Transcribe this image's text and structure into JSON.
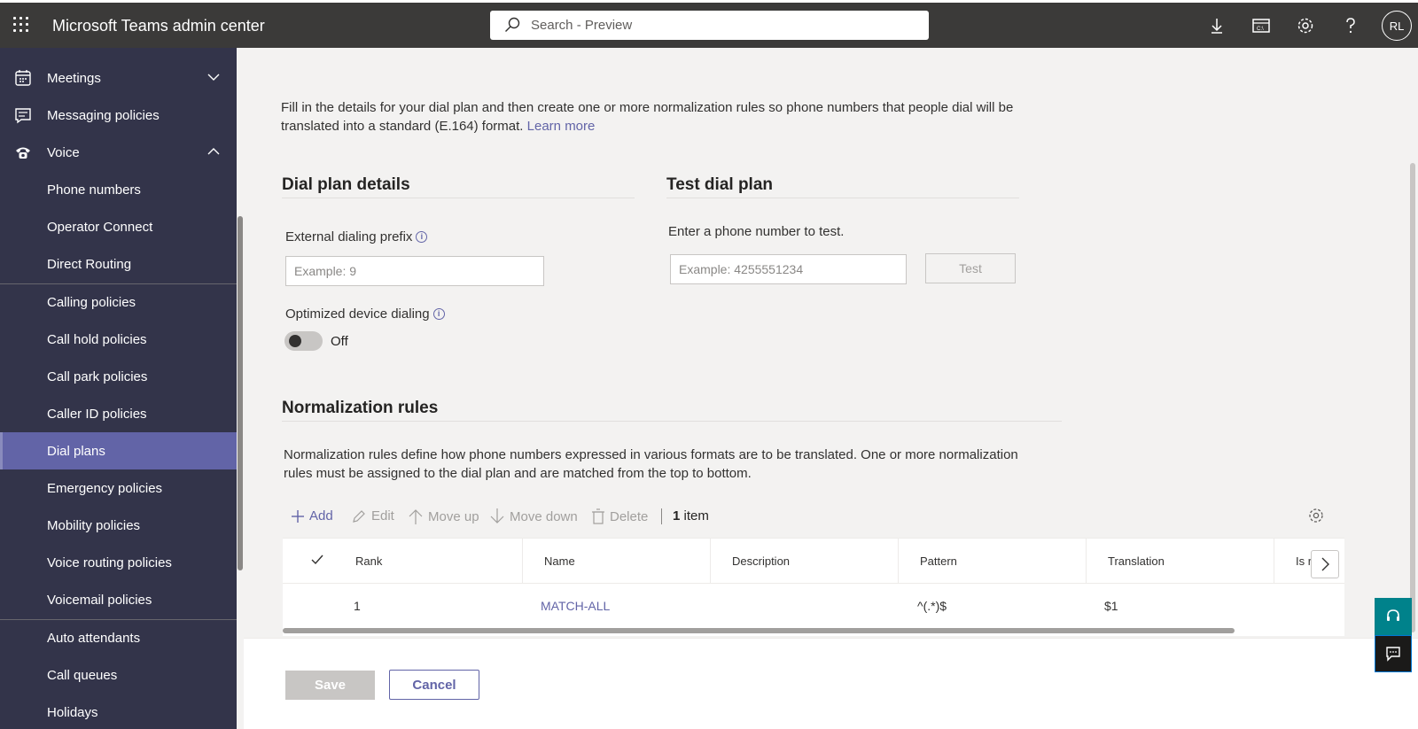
{
  "header": {
    "app_title": "Microsoft Teams admin center",
    "search_placeholder": "Search - Preview",
    "avatar_initials": "RL",
    "icons": [
      "waffle-icon",
      "search-icon",
      "download-icon",
      "shell-icon",
      "settings-icon",
      "help-icon"
    ]
  },
  "sidebar": {
    "items": [
      {
        "label": "Meetings",
        "icon": "calendar-icon",
        "expandable": true,
        "expanded": false
      },
      {
        "label": "Messaging policies",
        "icon": "chat-icon"
      },
      {
        "label": "Voice",
        "icon": "phone-icon",
        "expandable": true,
        "expanded": true
      },
      {
        "label": "Phone numbers"
      },
      {
        "label": "Operator Connect"
      },
      {
        "label": "Direct Routing"
      },
      {
        "label": "Calling policies"
      },
      {
        "label": "Call hold policies"
      },
      {
        "label": "Call park policies"
      },
      {
        "label": "Caller ID policies"
      },
      {
        "label": "Dial plans",
        "active": true
      },
      {
        "label": "Emergency policies"
      },
      {
        "label": "Mobility policies"
      },
      {
        "label": "Voice routing policies"
      },
      {
        "label": "Voicemail policies"
      },
      {
        "label": "Auto attendants"
      },
      {
        "label": "Call queues"
      },
      {
        "label": "Holidays"
      }
    ]
  },
  "intro": {
    "text": "Fill in the details for your dial plan and then create one or more normalization rules so phone numbers that people dial will be translated into a standard (E.164) format.",
    "link": "Learn more"
  },
  "dial_plan_details": {
    "title": "Dial plan details",
    "external_prefix_label": "External dialing prefix",
    "external_prefix_placeholder": "Example: 9",
    "optimized_label": "Optimized device dialing",
    "optimized_state": "Off"
  },
  "test_dial_plan": {
    "title": "Test dial plan",
    "prompt": "Enter a phone number to test.",
    "input_placeholder": "Example: 4255551234",
    "button": "Test"
  },
  "normalization": {
    "title": "Normalization rules",
    "description": "Normalization rules define how phone numbers expressed in various formats are to be translated. One or more normalization rules must be assigned to the dial plan and are matched from the top to bottom.",
    "commands": {
      "add": "Add",
      "edit": "Edit",
      "move_up": "Move up",
      "move_down": "Move down",
      "delete": "Delete",
      "count": "1",
      "count_label": "item"
    },
    "columns": [
      "Rank",
      "Name",
      "Description",
      "Pattern",
      "Translation",
      "Is r"
    ],
    "rows": [
      {
        "rank": "1",
        "name": "MATCH-ALL",
        "description": "",
        "pattern": "^(.*)$",
        "translation": "$1"
      }
    ]
  },
  "footer": {
    "save": "Save",
    "cancel": "Cancel"
  }
}
